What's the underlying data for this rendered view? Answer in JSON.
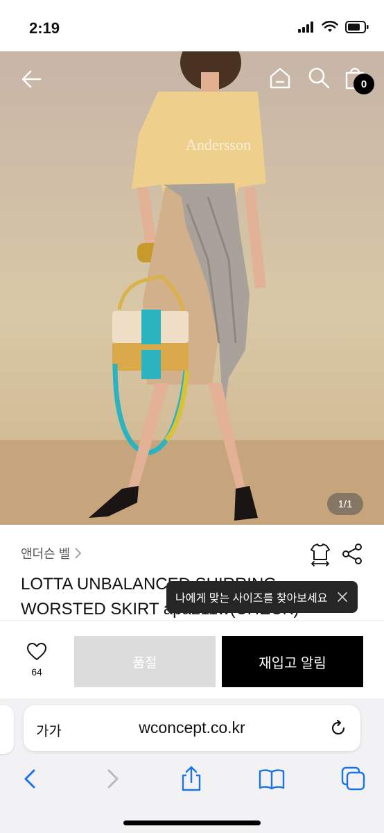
{
  "status_bar": {
    "time": "2:19"
  },
  "hero": {
    "page_indicator": "1/1",
    "cart_count": "0",
    "tshirt_print": "Andersson"
  },
  "product": {
    "brand": "앤더슨 벨",
    "title": "LOTTA UNBALANCED SHIRRING WORSTED SKIRT apa211w(CHECK)",
    "size_tooltip": "나에게 맞는 사이즈를 찾아보세요"
  },
  "purchase": {
    "like_count": "64",
    "soldout_label": "품절",
    "restock_label": "재입고 알림"
  },
  "browser": {
    "text_size_label": "가가",
    "url": "wconcept.co.kr"
  },
  "icons": [
    "back-arrow-icon",
    "home-icon",
    "search-icon",
    "cart-icon",
    "size-guide-icon",
    "share-icon",
    "close-icon",
    "heart-icon",
    "reload-icon",
    "safari-back-icon",
    "safari-forward-icon",
    "share-sheet-icon",
    "bookmarks-icon",
    "tabs-icon"
  ],
  "colors": {
    "accent_black": "#000000",
    "soldout_gray": "#dcdcdc",
    "safari_blue": "#1a73e8"
  }
}
